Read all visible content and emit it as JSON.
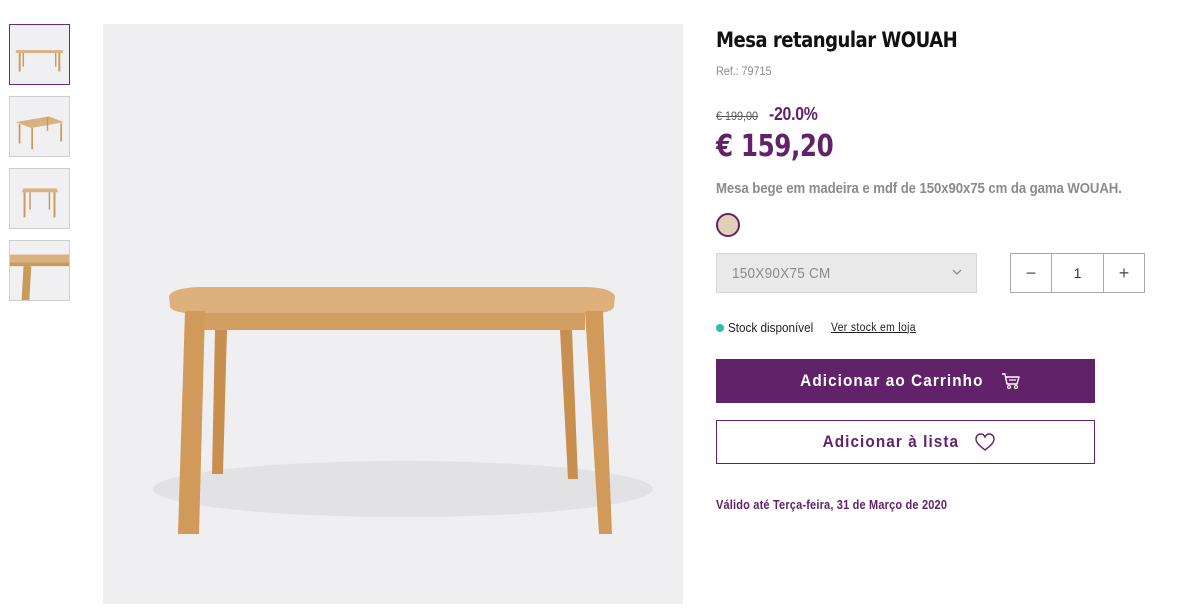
{
  "product": {
    "title": "Mesa retangular WOUAH",
    "ref_label": "Ref.:",
    "ref_value": "79715",
    "old_price": "€ 199,00",
    "discount": "-20.0%",
    "price": "€ 159,20",
    "description": "Mesa bege em madeira e mdf de 150x90x75 cm da gama WOUAH.",
    "swatch_color": "#e2d1b8",
    "size_selected": "150X90X75 CM",
    "quantity": "1",
    "minus_label": "−",
    "plus_label": "+",
    "stock_text": "Stock disponível",
    "stock_link": "Ver stock em loja",
    "add_to_cart": "Adicionar ao Carrinho",
    "add_to_list": "Adicionar à lista",
    "valid_until": "Válido até Terça-feira, 31 de Março de 2020"
  },
  "gallery": {
    "thumbnails": [
      "front-view",
      "angle-view",
      "side-view",
      "detail-view"
    ],
    "active_index": 0
  },
  "colors": {
    "brand": "#62226a",
    "stock": "#2bbfa8"
  },
  "icons": {
    "cart": "cart-icon",
    "heart": "heart-icon",
    "chevron": "chevron-down-icon"
  }
}
